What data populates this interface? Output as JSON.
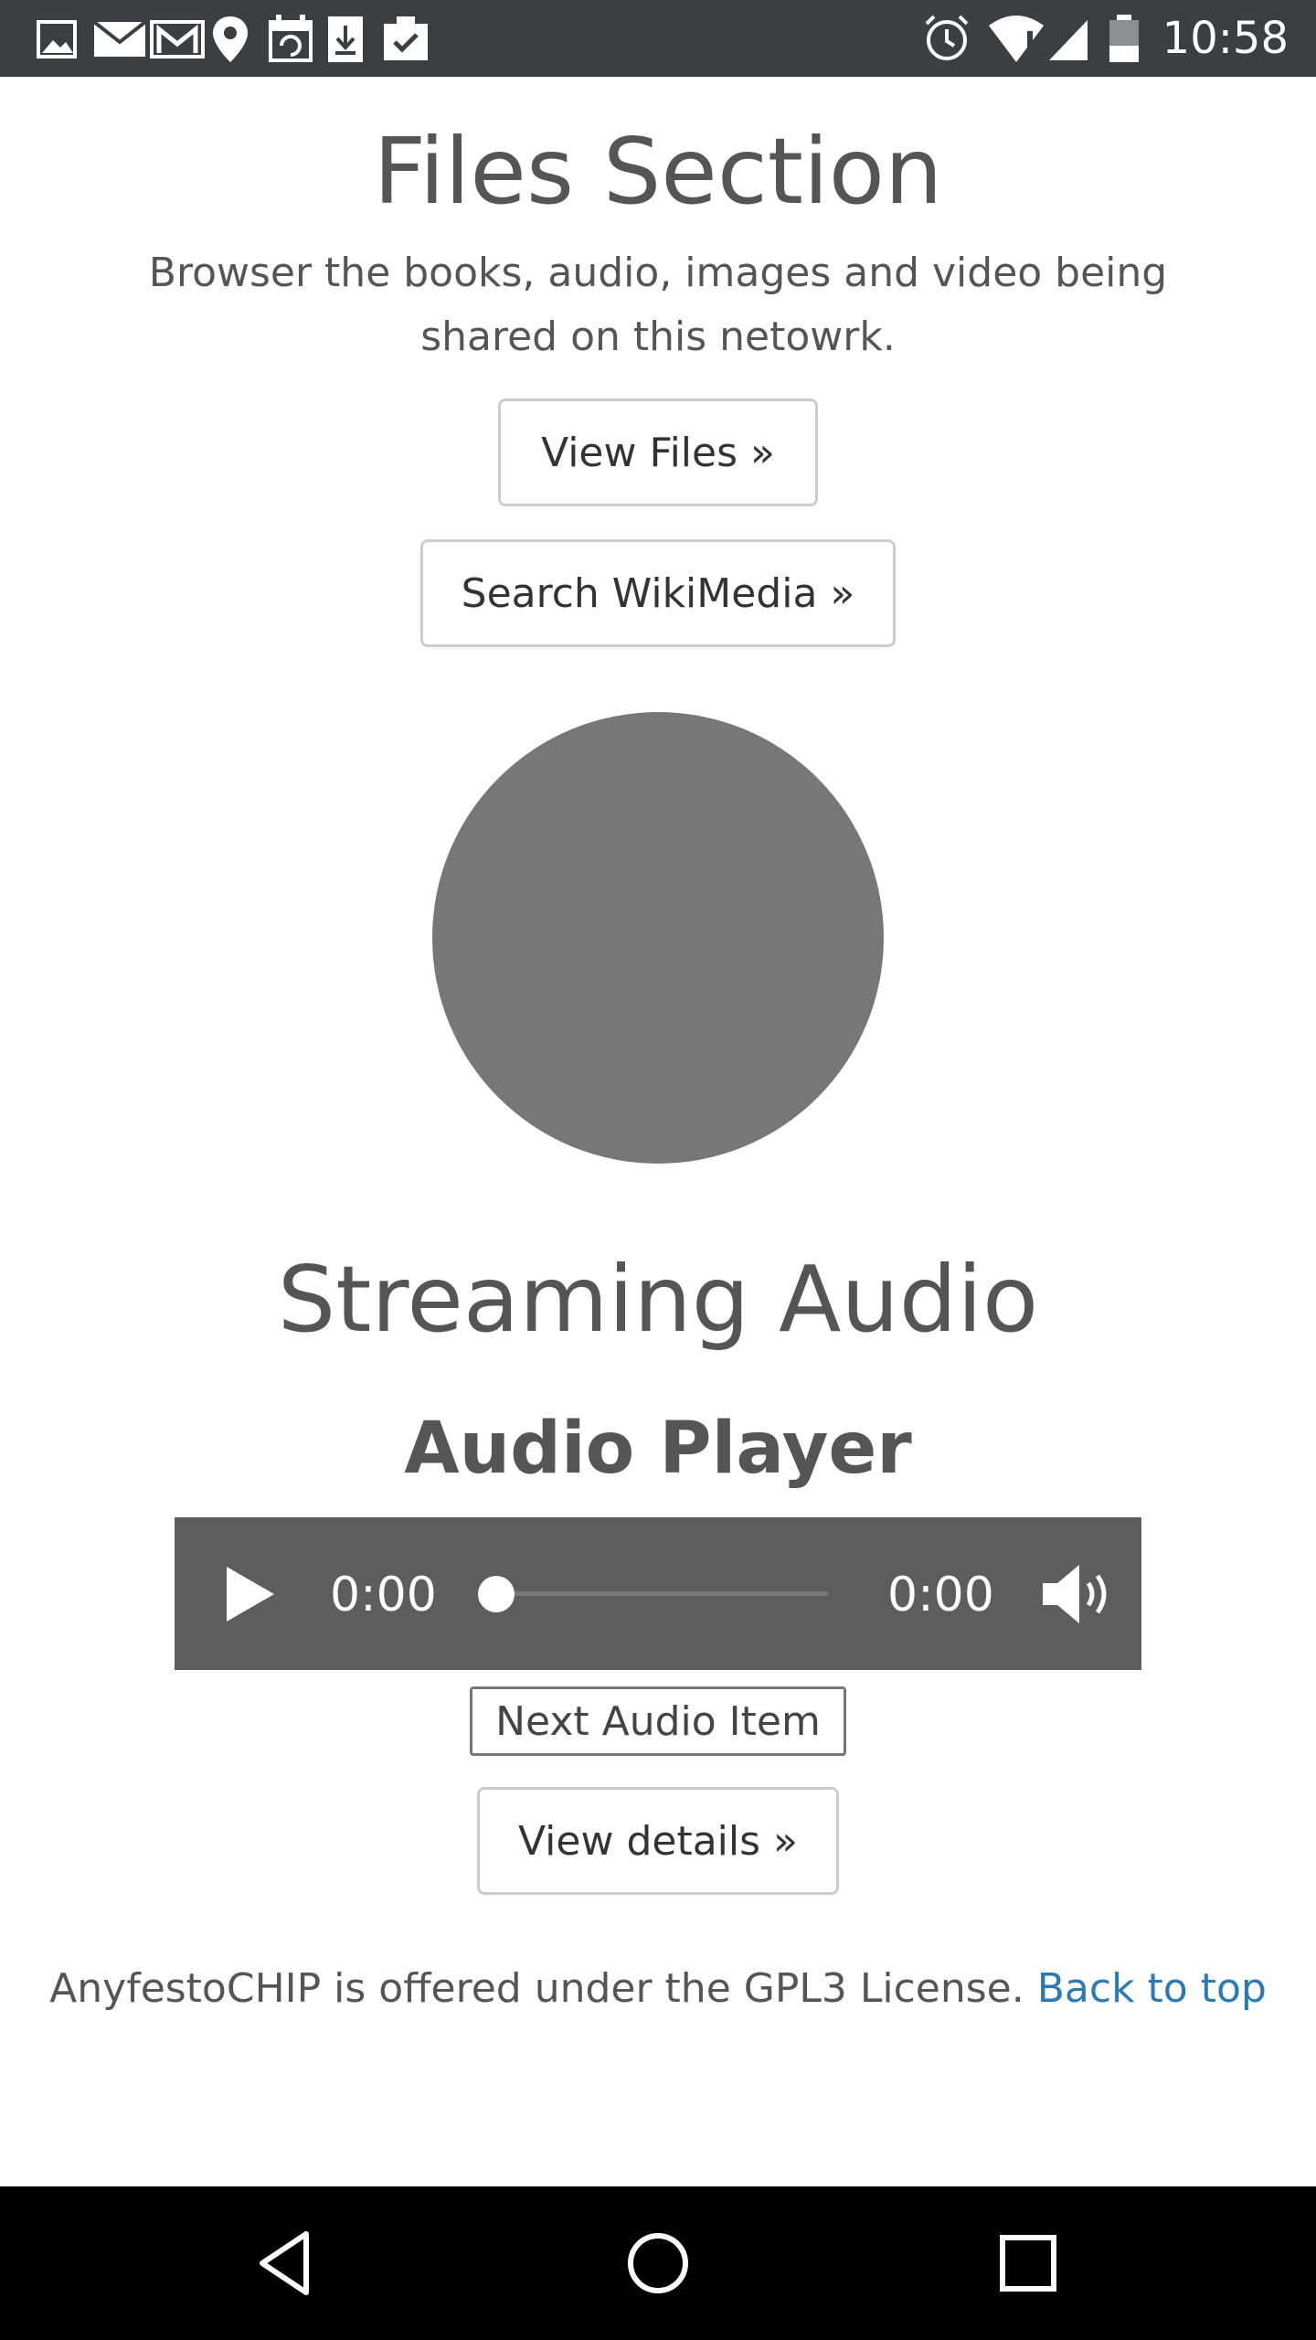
{
  "status_bar": {
    "time": "10:58",
    "left_icons": [
      "image-icon",
      "mail-icon",
      "gmail-icon",
      "location-pin-icon",
      "calendar-sync-icon",
      "download-icon",
      "clipboard-check-icon"
    ],
    "right_icons": [
      "alarm-icon",
      "wifi-alert-icon",
      "signal-icon",
      "battery-icon"
    ]
  },
  "files_section": {
    "title": "Files Section",
    "description": "Browser the books, audio, images and video being shared on this netowrk.",
    "view_files_label": "View Files »",
    "search_wikimedia_label": "Search WikiMedia »"
  },
  "placeholder_circle": {
    "color": "#777777"
  },
  "streaming": {
    "title": "Streaming Audio",
    "player_title": "Audio Player",
    "player": {
      "current_time": "0:00",
      "duration": "0:00",
      "progress": 0
    },
    "next_audio_label": "Next Audio Item",
    "view_details_label": "View details »"
  },
  "footer": {
    "license_text": "AnyfestoCHIP is offered under the GPL3 License.",
    "back_to_top_label": "Back to top",
    "link_color": "#2a7ab8"
  },
  "nav_bar": {
    "icons": [
      "back-icon",
      "home-icon",
      "recents-icon"
    ]
  }
}
